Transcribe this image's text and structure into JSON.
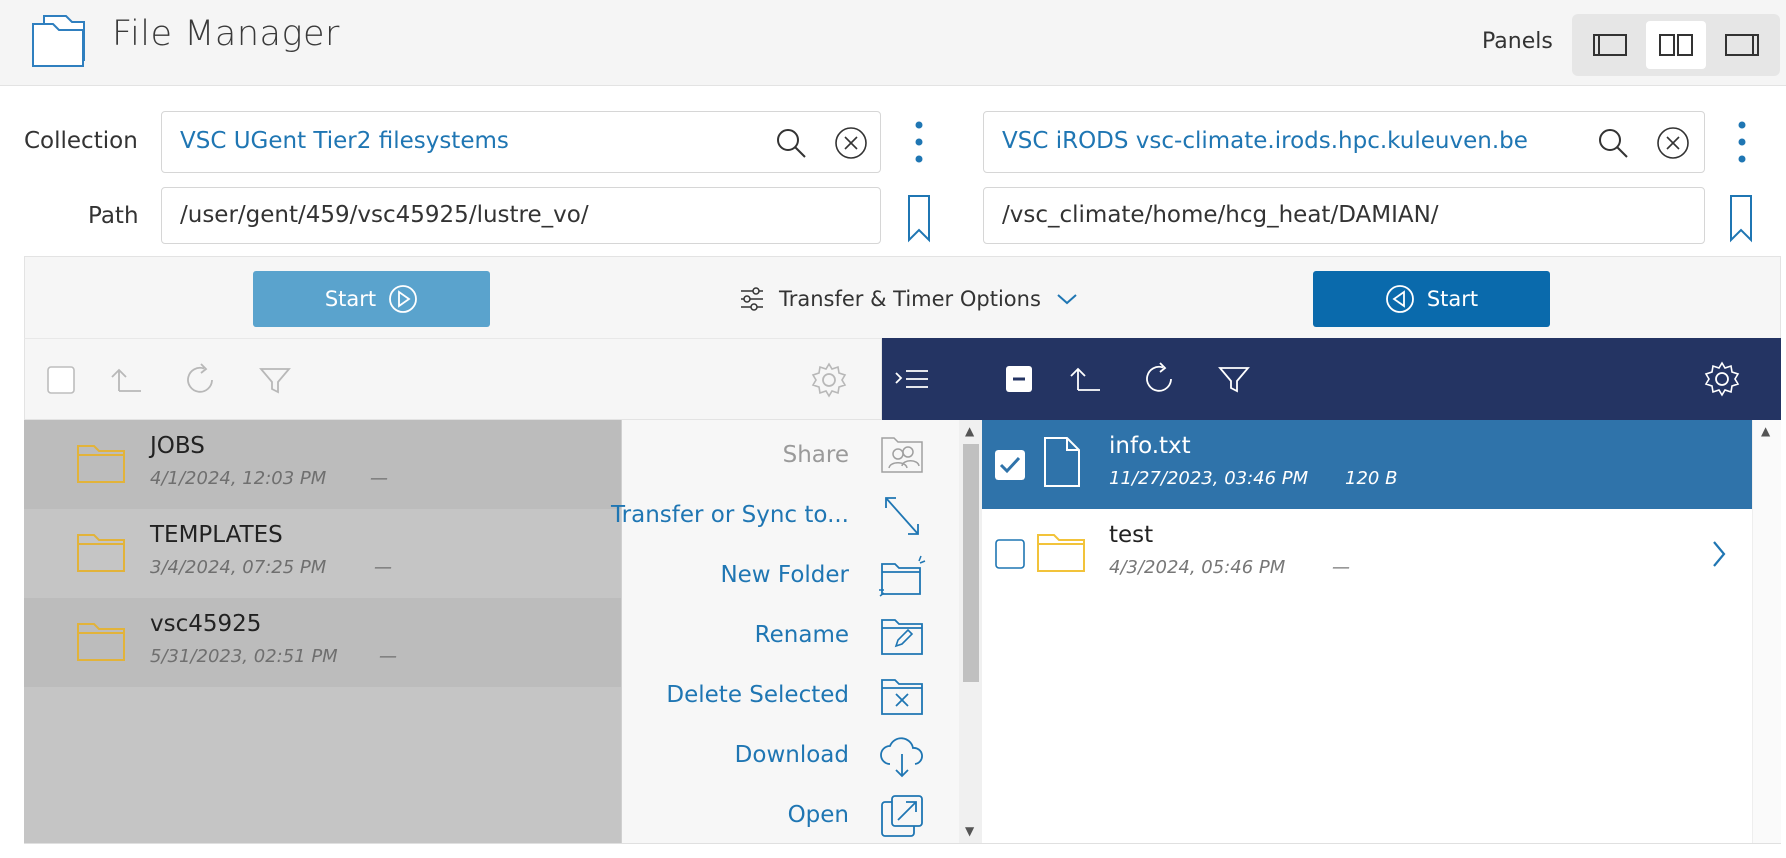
{
  "header": {
    "title": "File Manager",
    "panels_label": "Panels"
  },
  "left": {
    "collection_label": "Collection",
    "path_label": "Path",
    "collection": "VSC UGent Tier2 filesystems",
    "path": "/user/gent/459/vsc45925/lustre_vo/",
    "start_label": "Start",
    "files": [
      {
        "name": "JOBS",
        "date": "4/1/2024, 12:03 PM",
        "size": "—"
      },
      {
        "name": "TEMPLATES",
        "date": "3/4/2024, 07:25 PM",
        "size": "—"
      },
      {
        "name": "vsc45925",
        "date": "5/31/2023, 02:51 PM",
        "size": "—"
      }
    ]
  },
  "transfer": {
    "options_label": "Transfer & Timer Options"
  },
  "context_menu": [
    {
      "label": "Share",
      "enabled": false,
      "icon": "share-icon"
    },
    {
      "label": "Transfer or Sync to...",
      "enabled": true,
      "icon": "transfer-icon"
    },
    {
      "label": "New Folder",
      "enabled": true,
      "icon": "new-folder-icon"
    },
    {
      "label": "Rename",
      "enabled": true,
      "icon": "rename-icon"
    },
    {
      "label": "Delete Selected",
      "enabled": true,
      "icon": "delete-icon"
    },
    {
      "label": "Download",
      "enabled": true,
      "icon": "download-icon"
    },
    {
      "label": "Open",
      "enabled": true,
      "icon": "open-icon"
    }
  ],
  "right": {
    "collection": "VSC iRODS vsc-climate.irods.hpc.kuleuven.be",
    "path": "/vsc_climate/home/hcg_heat/DAMIAN/",
    "start_label": "Start",
    "files": [
      {
        "name": "info.txt",
        "date": "11/27/2023, 03:46 PM",
        "size": "120 B",
        "selected": true
      },
      {
        "name": "test",
        "date": "4/3/2024, 05:46 PM",
        "size": "—",
        "selected": false
      }
    ]
  },
  "colors": {
    "accent": "#1f76b3",
    "start_left": "#5aa3cd",
    "start_right": "#0a6aac",
    "dark_toolbar": "#243463",
    "selected_row": "#2f73aa",
    "folder": "#e2b33a"
  }
}
